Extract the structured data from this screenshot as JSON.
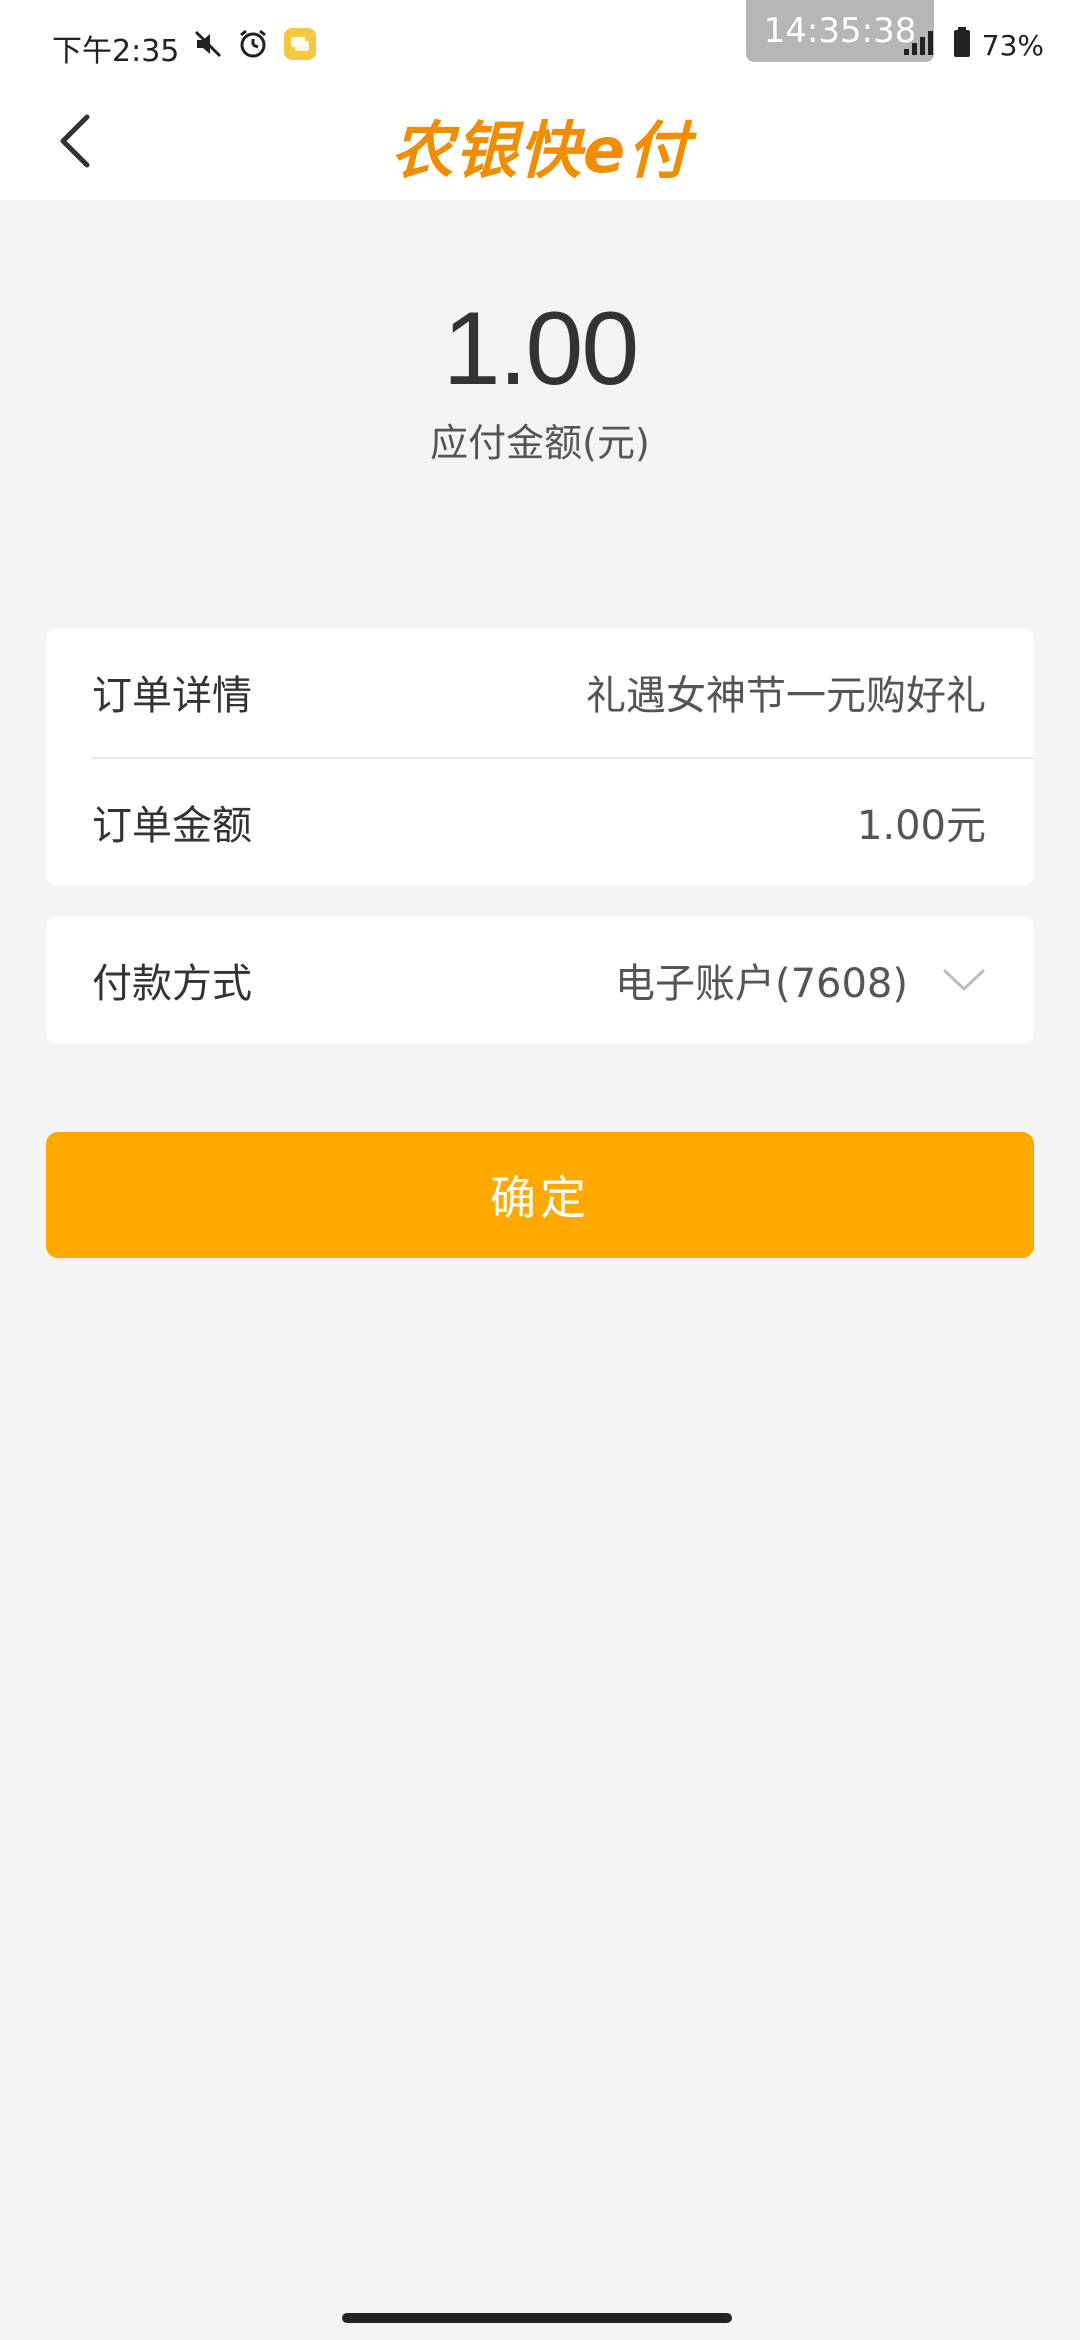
{
  "status_bar": {
    "time": "下午2:35",
    "clock_overlay": "14:35:38",
    "battery": "73%",
    "icons": [
      "mute-icon",
      "alarm-icon",
      "message-app-icon",
      "signal-icon",
      "battery-icon"
    ]
  },
  "header": {
    "brand": "农银快e付",
    "back_icon": "chevron-left-icon"
  },
  "amount": {
    "value": "1.00",
    "label": "应付金额(元)"
  },
  "order": {
    "detail_label": "订单详情",
    "detail_value": "礼遇女神节一元购好礼",
    "amount_label": "订单金额",
    "amount_value": "1.00元"
  },
  "payment": {
    "method_label": "付款方式",
    "method_value": "电子账户(7608)",
    "dropdown_icon": "chevron-down-icon"
  },
  "actions": {
    "confirm_label": "确定"
  },
  "colors": {
    "brand_orange": "#f08d00",
    "button_orange": "#ffa800",
    "background": "#f4f4f4"
  }
}
